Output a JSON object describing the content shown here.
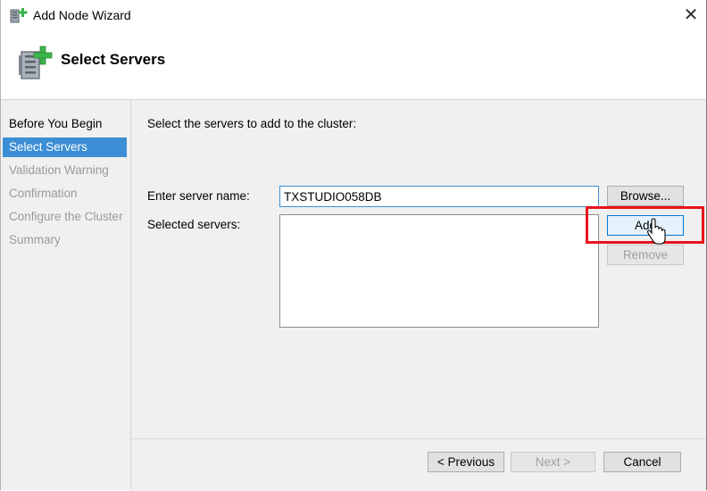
{
  "window": {
    "title": "Add Node Wizard",
    "close_glyph": "✕",
    "app_icon": "server-add-icon"
  },
  "header": {
    "title": "Select Servers",
    "icon": "server-add-icon"
  },
  "nav": {
    "items": [
      {
        "label": "Before You Begin",
        "state": "done"
      },
      {
        "label": "Select Servers",
        "state": "active"
      },
      {
        "label": "Validation Warning",
        "state": "pending"
      },
      {
        "label": "Confirmation",
        "state": "pending"
      },
      {
        "label": "Configure the Cluster",
        "state": "pending"
      },
      {
        "label": "Summary",
        "state": "pending"
      }
    ]
  },
  "main": {
    "instruction": "Select the servers to add to the cluster:",
    "server_name_label": "Enter server name:",
    "server_name_value": "TXSTUDIO058DB",
    "selected_servers_label": "Selected servers:",
    "browse_label": "Browse...",
    "add_label": "Add",
    "remove_label": "Remove"
  },
  "footer": {
    "previous_label": "< Previous",
    "next_label": "Next >",
    "cancel_label": "Cancel"
  },
  "colors": {
    "accent": "#3c8fd4",
    "highlight": "#e8141b",
    "panel": "#f0f0f0"
  }
}
